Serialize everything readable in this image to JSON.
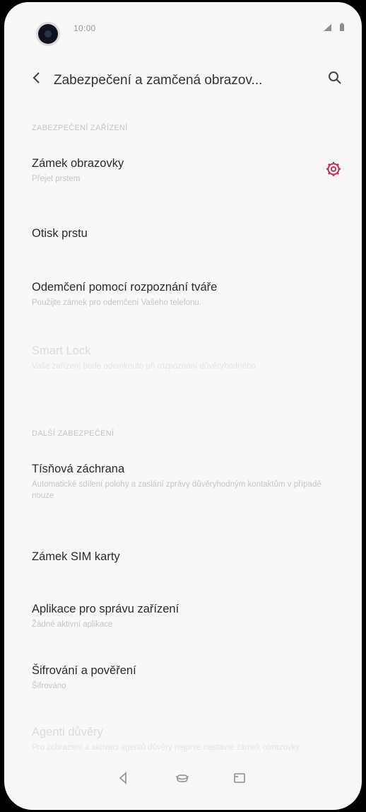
{
  "status_bar": {
    "time": "10:00",
    "icons": [
      "signal-icon",
      "battery-icon"
    ]
  },
  "header": {
    "title": "Zabezpečení a zamčená obrazov...",
    "back_icon": "back-arrow-icon",
    "search_icon": "search-icon"
  },
  "sections": [
    {
      "label": "ZABEZPEČENÍ ZAŘÍZENÍ",
      "items": [
        {
          "title": "Zámek obrazovky",
          "subtitle": "Přejet prstem",
          "has_settings": true
        },
        {
          "title": "Otisk prstu",
          "subtitle": ""
        },
        {
          "title": "Odemčení pomocí rozpoznání tváře",
          "subtitle": "Použijte zámek pro odemčení Vašeho telefonu."
        },
        {
          "title": "Smart Lock",
          "subtitle": "Vaše zařízení bude odemknuto při rozpoznání důvěryhodného",
          "disabled": true
        }
      ]
    },
    {
      "label": "DALŠÍ ZABEZPEČENÍ",
      "items": [
        {
          "title": "Tísňová záchrana",
          "subtitle": "Automatické sdílení polohy a zaslání zprávy důvěryhodným kontaktům v případě nouze"
        },
        {
          "title": "Zámek SIM karty",
          "subtitle": ""
        },
        {
          "title": "Aplikace pro správu zařízení",
          "subtitle": "Žádné aktivní aplikace"
        },
        {
          "title": "Šifrování a pověření",
          "subtitle": "Šifrováno"
        },
        {
          "title": "Agenti důvěry",
          "subtitle": "Pro zobrazení a aktivaci agentů důvěry nejprve nastavte zámek obrazovky",
          "disabled": true
        }
      ]
    }
  ],
  "nav": {
    "icons": [
      "recent-apps-icon",
      "home-icon",
      "back-icon"
    ]
  },
  "colors": {
    "accent": "#c4305a",
    "background": "#f7f7f7"
  }
}
